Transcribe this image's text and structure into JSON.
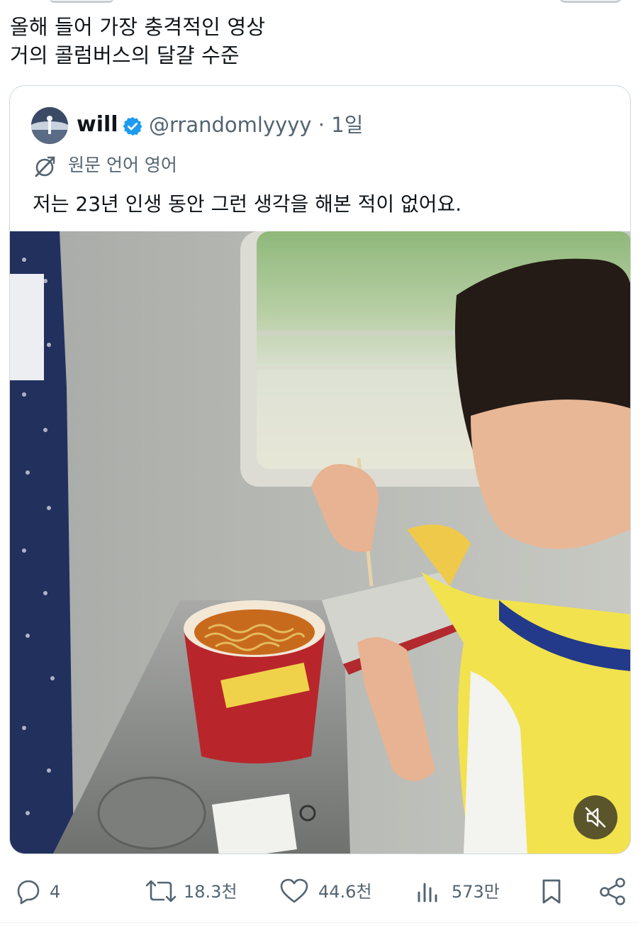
{
  "post": {
    "text_lines": [
      "올해 들어 가장 충격적인 영상",
      "거의 콜럼버스의 달걀 수준"
    ]
  },
  "quote": {
    "name": "will",
    "handle_time": "@rrandomlyyyy · 1일",
    "translation_label": "원문 언어 영어",
    "text": "저는 23년 인생 동안 그런 생각을 해본 적이 없어요.",
    "verified_color": "#1d9bf0"
  },
  "media": {
    "muted": true
  },
  "actions": {
    "reply": {
      "icon": "reply-icon",
      "count": "4"
    },
    "repost": {
      "icon": "repost-icon",
      "count": "18.3천"
    },
    "like": {
      "icon": "heart-icon",
      "count": "44.6천"
    },
    "views": {
      "icon": "views-icon",
      "count": "573만"
    },
    "bookmark": {
      "icon": "bookmark-icon"
    },
    "share": {
      "icon": "share-icon"
    }
  },
  "colors": {
    "text": "#0f1419",
    "secondary": "#536471",
    "border": "#cfd9de"
  }
}
